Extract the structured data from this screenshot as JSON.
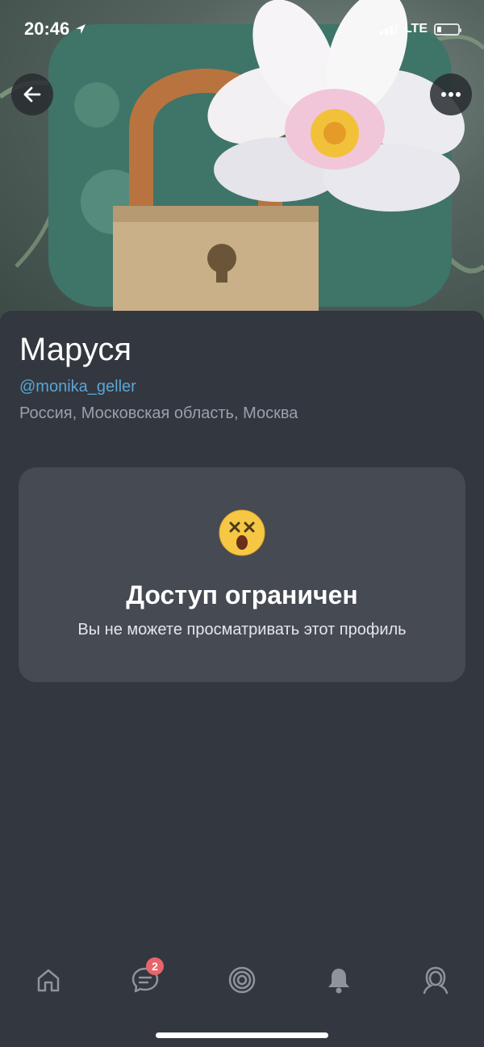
{
  "status_bar": {
    "time": "20:46",
    "network": "LTE",
    "battery_level": 0.2
  },
  "cover": {
    "image_description_icon": "padlock-lotus-image"
  },
  "header_buttons": {
    "back_icon": "arrow-left-icon",
    "more_icon": "ellipsis-icon"
  },
  "profile": {
    "name": "Маруся",
    "handle": "@monika_geller",
    "location": "Россия, Московская область, Москва"
  },
  "restricted": {
    "emoji": "dizzy-face-emoji",
    "title": "Доступ ограничен",
    "text": "Вы не можете просматривать этот профиль"
  },
  "tab_bar": {
    "tabs": [
      {
        "icon": "home-icon"
      },
      {
        "icon": "messages-icon",
        "badge": "2"
      },
      {
        "icon": "target-icon"
      },
      {
        "icon": "bell-icon"
      },
      {
        "icon": "profile-icon"
      }
    ]
  },
  "colors": {
    "background": "#33373f",
    "card": "#464a52",
    "handle": "#5aa5d6",
    "badge": "#e8646a"
  }
}
